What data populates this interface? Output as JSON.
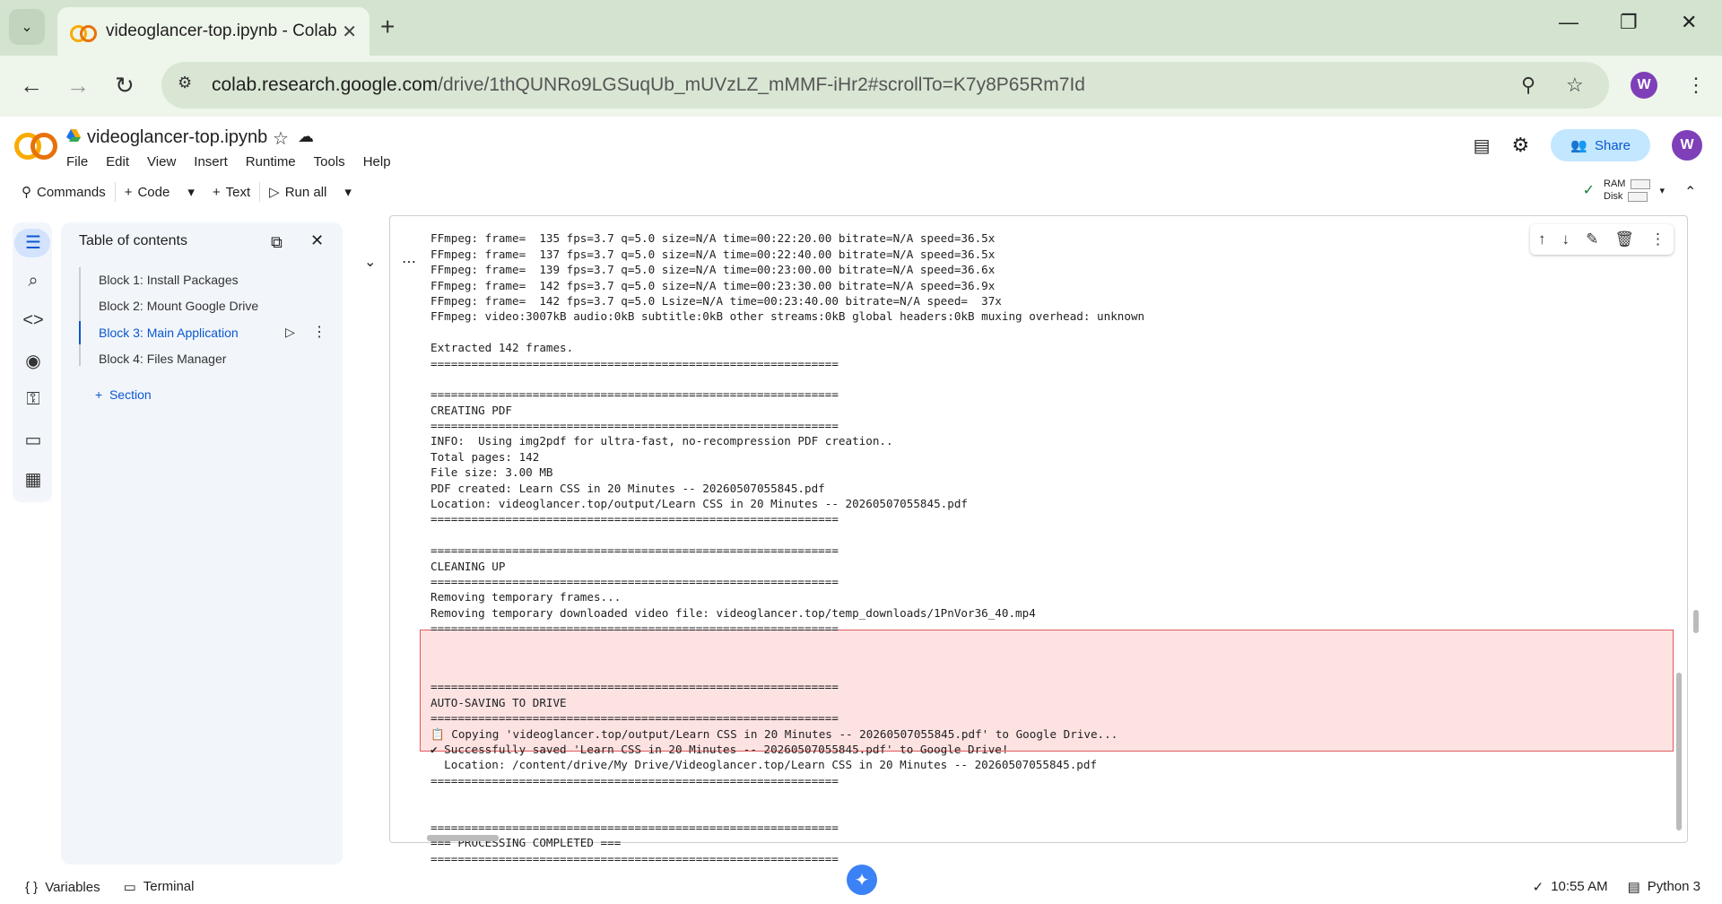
{
  "browser": {
    "tab_title": "videoglancer-top.ipynb - Colab",
    "url_host": "colab.research.google.com",
    "url_path": "/drive/1thQUNRo9LGSuqUb_mUVzLZ_mMMF-iHr2#scrollTo=K7y8P65Rm7Id",
    "profile_initial": "W"
  },
  "colab": {
    "notebook_title": "videoglancer-top.ipynb",
    "menu": [
      "File",
      "Edit",
      "View",
      "Insert",
      "Runtime",
      "Tools",
      "Help"
    ],
    "share_label": "Share",
    "profile_initial": "W",
    "toolbar": {
      "commands": "Commands",
      "code": "Code",
      "text": "Text",
      "run_all": "Run all"
    },
    "resources": {
      "ram": "RAM",
      "disk": "Disk"
    }
  },
  "toc": {
    "title": "Table of contents",
    "items": [
      "Block 1: Install Packages",
      "Block 2: Mount Google Drive",
      "Block 3: Main Application",
      "Block 4: Files Manager"
    ],
    "active_index": 2,
    "add_section": "Section"
  },
  "output": {
    "lines_top": [
      "FFmpeg: frame=  135 fps=3.7 q=5.0 size=N/A time=00:22:20.00 bitrate=N/A speed=36.5x",
      "FFmpeg: frame=  137 fps=3.7 q=5.0 size=N/A time=00:22:40.00 bitrate=N/A speed=36.5x",
      "FFmpeg: frame=  139 fps=3.7 q=5.0 size=N/A time=00:23:00.00 bitrate=N/A speed=36.6x",
      "FFmpeg: frame=  142 fps=3.7 q=5.0 size=N/A time=00:23:30.00 bitrate=N/A speed=36.9x",
      "FFmpeg: frame=  142 fps=3.7 q=5.0 Lsize=N/A time=00:23:40.00 bitrate=N/A speed=  37x",
      "FFmpeg: video:3007kB audio:0kB subtitle:0kB other streams:0kB global headers:0kB muxing overhead: unknown",
      "",
      "Extracted 142 frames.",
      "============================================================",
      "",
      "============================================================",
      "CREATING PDF",
      "============================================================",
      "INFO:  Using img2pdf for ultra-fast, no-recompression PDF creation..",
      "Total pages: 142",
      "File size: 3.00 MB",
      "PDF created: Learn CSS in 20 Minutes -- 20260507055845.pdf",
      "Location: videoglancer.top/output/Learn CSS in 20 Minutes -- 20260507055845.pdf",
      "============================================================",
      "",
      "============================================================",
      "CLEANING UP",
      "============================================================",
      "Removing temporary frames...",
      "Removing temporary downloaded video file: videoglancer.top/temp_downloads/1PnVor36_40.mp4",
      "============================================================"
    ],
    "lines_err": [
      "============================================================",
      "AUTO-SAVING TO DRIVE",
      "============================================================",
      "📋 Copying 'videoglancer.top/output/Learn CSS in 20 Minutes -- 20260507055845.pdf' to Google Drive...",
      "✔ Successfully saved 'Learn CSS in 20 Minutes -- 20260507055845.pdf' to Google Drive!",
      "  Location: /content/drive/My Drive/Videoglancer.top/Learn CSS in 20 Minutes -- 20260507055845.pdf",
      "============================================================"
    ],
    "lines_bottom": [
      "",
      "============================================================",
      "=== PROCESSING COMPLETED ===",
      "============================================================"
    ]
  },
  "statusbar": {
    "variables": "Variables",
    "terminal": "Terminal",
    "time": "10:55 AM",
    "runtime": "Python 3"
  }
}
